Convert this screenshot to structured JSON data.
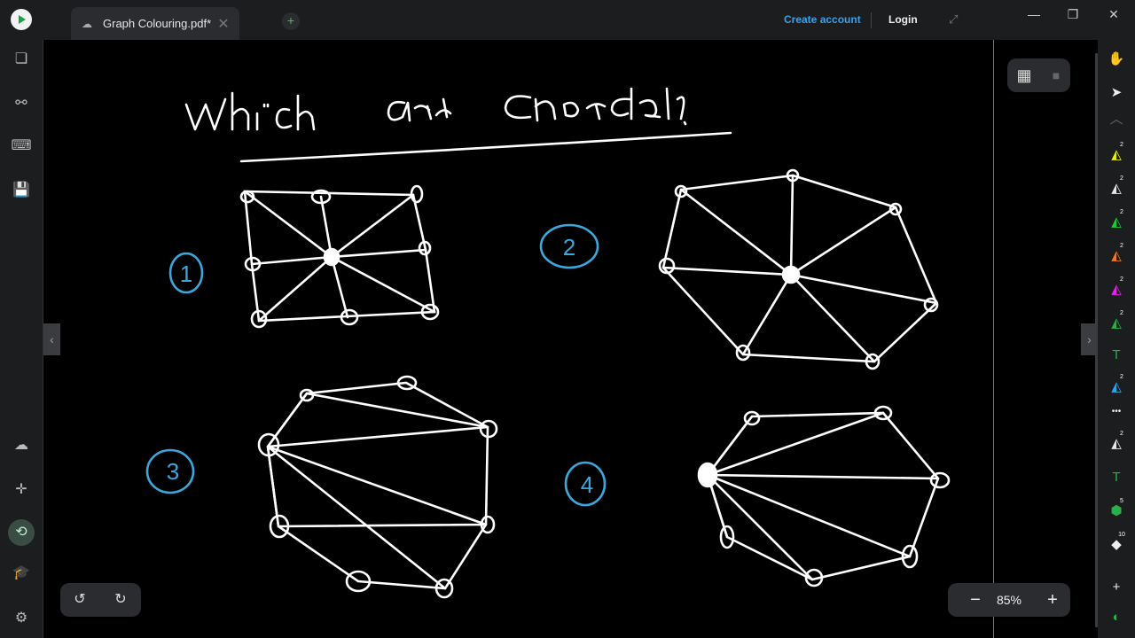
{
  "app": {
    "tab_title": "Graph Colouring.pdf*",
    "new_tab": "+",
    "create_account": "Create account",
    "login": "Login"
  },
  "canvas": {
    "heading": "Which are chordal?",
    "graph_labels": [
      "1",
      "2",
      "3",
      "4"
    ],
    "ink_white": "#ffffff",
    "ink_blue": "#3ba8dc"
  },
  "toolbar": {
    "zoom_minus": "−",
    "zoom_level": "85%",
    "zoom_plus": "+"
  },
  "right_tools": [
    {
      "name": "hand-tool-icon",
      "glyph": "✋",
      "color": "#eeeeee",
      "badge": ""
    },
    {
      "name": "pointer-tool-icon",
      "glyph": "➤",
      "color": "#eeeeee",
      "badge": ""
    },
    {
      "name": "collapse-up-icon",
      "glyph": "︿",
      "color": "#666666",
      "badge": ""
    },
    {
      "name": "highlighter-yellow-icon",
      "glyph": "◭",
      "color": "#e8e81a",
      "badge": "2"
    },
    {
      "name": "pen-white-icon",
      "glyph": "◭",
      "color": "#e6e6e6",
      "badge": "2"
    },
    {
      "name": "pen-green-icon",
      "glyph": "◭",
      "color": "#22c83a",
      "badge": "2"
    },
    {
      "name": "pen-orange-icon",
      "glyph": "◭",
      "color": "#f07828",
      "badge": "2"
    },
    {
      "name": "pen-magenta-icon",
      "glyph": "◭",
      "color": "#e624e6",
      "badge": "2"
    },
    {
      "name": "pen-green-dark-icon",
      "glyph": "◭",
      "color": "#2ab04a",
      "badge": "2"
    },
    {
      "name": "text-tool-icon",
      "glyph": "T",
      "color": "#2ab04a",
      "badge": ""
    },
    {
      "name": "pen-blue-icon",
      "glyph": "◭",
      "color": "#2aa8e6",
      "badge": "2"
    },
    {
      "name": "more-tools-icon",
      "glyph": "•••",
      "color": "#eeeeee",
      "badge": ""
    },
    {
      "name": "pen-white-2-icon",
      "glyph": "◭",
      "color": "#e6e6e6",
      "badge": "2"
    },
    {
      "name": "text-tool-2-icon",
      "glyph": "T",
      "color": "#2ab04a",
      "badge": ""
    },
    {
      "name": "shape-tool-icon",
      "glyph": "⬢",
      "color": "#2ab04a",
      "badge": "5"
    },
    {
      "name": "eraser-tool-icon",
      "glyph": "◆",
      "color": "#eeeeee",
      "badge": "10"
    },
    {
      "name": "add-tool-icon",
      "glyph": "+",
      "color": "#eeeeee",
      "badge": ""
    },
    {
      "name": "app-switch-icon",
      "glyph": "◐",
      "color": "#2ab04a",
      "badge": ""
    }
  ]
}
